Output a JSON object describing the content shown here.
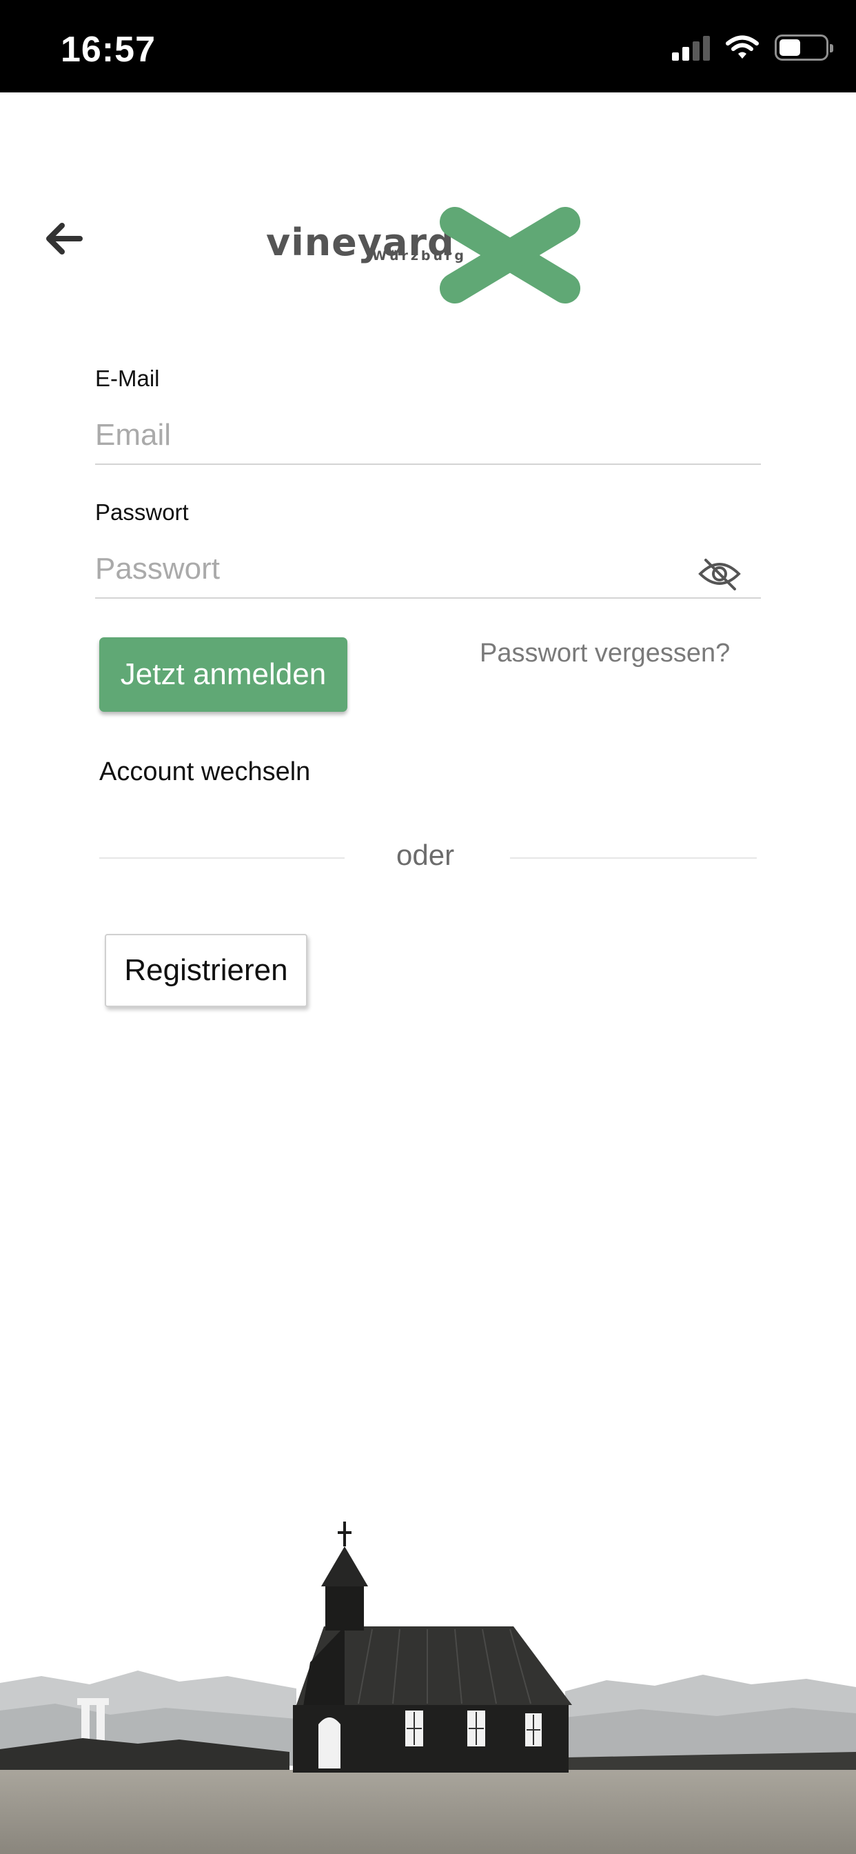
{
  "status_bar": {
    "time": "16:57"
  },
  "logo": {
    "wordmark": "vineyard",
    "subtitle": "Würzburg"
  },
  "form": {
    "email_label": "E-Mail",
    "email_placeholder": "Email",
    "password_label": "Passwort",
    "password_placeholder": "Passwort",
    "login_button": "Jetzt anmelden",
    "forgot_password": "Passwort vergessen?",
    "switch_account": "Account wechseln",
    "divider_text": "oder",
    "register_button": "Registrieren"
  },
  "colors": {
    "accent": "#60a875",
    "status_bar": "#000000",
    "text": "#111111",
    "muted": "#7a7a7a"
  },
  "icons": {
    "back": "arrow-left-icon",
    "password_visibility": "eye-off-icon"
  }
}
